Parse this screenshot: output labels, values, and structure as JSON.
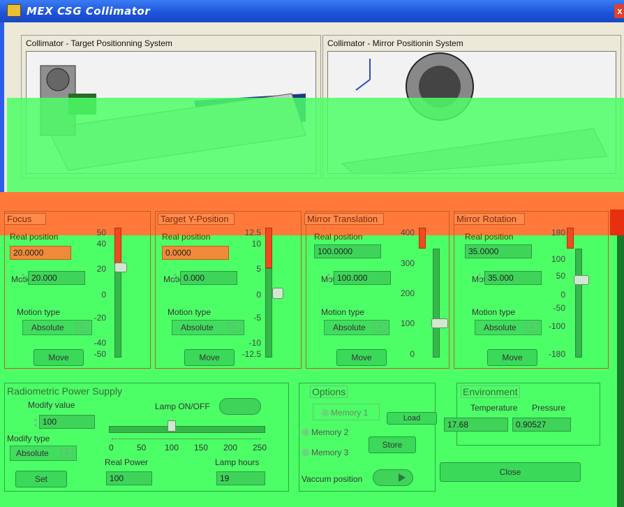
{
  "window": {
    "title": "MEX CSG Collimator",
    "close_label": "x"
  },
  "panels": {
    "target_title": "Collimator - Target Positionning System",
    "mirror_title": "Collimator - Mirror Positionin System"
  },
  "groups": [
    {
      "title": "Focus",
      "real_label": "Real position",
      "real_value": "20.0000",
      "motion_label": "Motion Value",
      "motion_value": "20.000",
      "type_label": "Motion type",
      "type_value": "Absolute",
      "move_label": "Move",
      "ticks": [
        "50",
        "40",
        "20",
        "0",
        "-20",
        "-40",
        "-50"
      ]
    },
    {
      "title": "Target Y-Position",
      "real_label": "Real position",
      "real_value": "0.0000",
      "motion_label": "Motion value",
      "motion_value": "0.000",
      "type_label": "Motion type",
      "type_value": "Absolute",
      "move_label": "Move",
      "ticks": [
        "12.5",
        "10",
        "5",
        "0",
        "-5",
        "-10",
        "-12.5"
      ]
    },
    {
      "title": "Mirror Translation",
      "real_label": "Real position",
      "real_value": "100.0000",
      "motion_label": "Motion Value",
      "motion_value": "100.000",
      "type_label": "Motion type",
      "type_value": "Absolute",
      "move_label": "Move",
      "ticks": [
        "400",
        "300",
        "200",
        "100",
        "0"
      ]
    },
    {
      "title": "Mirror Rotation",
      "real_label": "Real position",
      "real_value": "35.0000",
      "motion_label": "Motion Value",
      "motion_value": "35.000",
      "type_label": "Motion type",
      "type_value": "Absolute",
      "move_label": "Move",
      "ticks": [
        "180",
        "100",
        "50",
        "0",
        "-50",
        "-100",
        "-180"
      ]
    }
  ],
  "radiometric": {
    "title": "Radiometric Power Supply",
    "modify_value_label": "Modify value",
    "modify_value": "100",
    "modify_type_label": "Modify type",
    "modify_type_value": "Absolute",
    "set_label": "Set",
    "lamp_label": "Lamp ON/OFF",
    "scale": [
      "0",
      "50",
      "100",
      "150",
      "200",
      "250"
    ],
    "real_power_label": "Real Power",
    "real_power_value": "100",
    "lamp_hours_label": "Lamp hours",
    "lamp_hours_value": "19",
    "slider_value": 100
  },
  "options": {
    "title": "Options",
    "memory1": "Memory 1",
    "memory2": "Memory 2",
    "memory3": "Memory 3",
    "load_label": "Load",
    "store_label": "Store",
    "vacuum_label": "Vaccum position"
  },
  "environment": {
    "title": "Environment",
    "temperature_label": "Temperature",
    "temperature_value": "17.68",
    "pressure_label": "Pressure",
    "pressure_value": "0.90527",
    "close_label": "Close"
  }
}
